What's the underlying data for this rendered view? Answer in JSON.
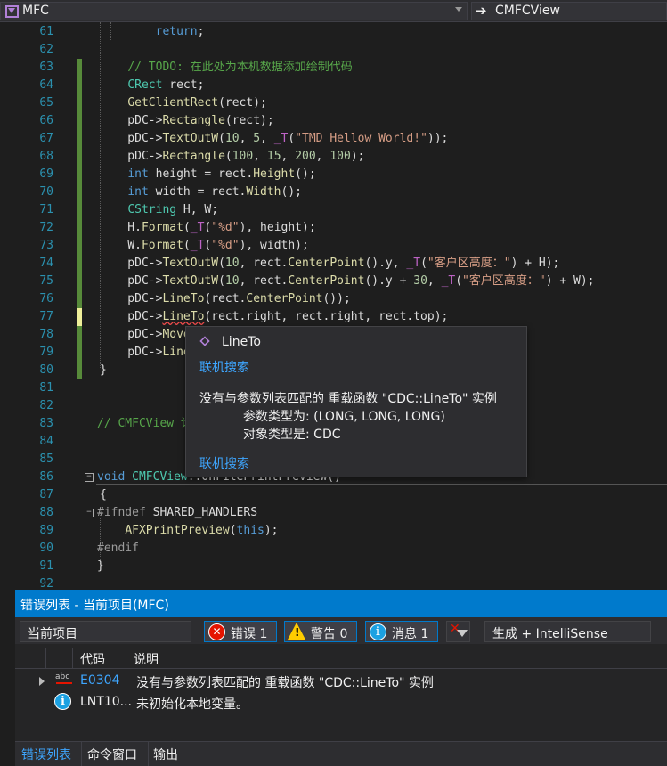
{
  "nav": {
    "project": "MFC",
    "member": "CMFCView"
  },
  "editor": {
    "lines": [
      {
        "n": "61",
        "html": "        <span class=\"kw\">return</span>;"
      },
      {
        "n": "62",
        "html": ""
      },
      {
        "n": "63",
        "html": "    <span class=\"cm\">// TODO: 在此处为本机数据添加绘制代码</span>"
      },
      {
        "n": "64",
        "html": "    <span class=\"ty\">CRect</span> rect;"
      },
      {
        "n": "65",
        "html": "    <span class=\"fn\">GetClientRect</span>(rect);"
      },
      {
        "n": "66",
        "html": "    pDC-&gt;<span class=\"fn\">Rectangle</span>(rect);"
      },
      {
        "n": "67",
        "html": "    pDC-&gt;<span class=\"fn\">TextOutW</span>(<span class=\"num\">10</span>, <span class=\"num\">5</span>, <span class=\"mac\">_T</span>(<span class=\"str\">\"TMD Hellow World!\"</span>));"
      },
      {
        "n": "68",
        "html": "    pDC-&gt;<span class=\"fn\">Rectangle</span>(<span class=\"num\">100</span>, <span class=\"num\">15</span>, <span class=\"num\">200</span>, <span class=\"num\">100</span>);"
      },
      {
        "n": "69",
        "html": "    <span class=\"kw\">int</span> height = rect.<span class=\"fn\">Height</span>();"
      },
      {
        "n": "70",
        "html": "    <span class=\"kw\">int</span> width = rect.<span class=\"fn\">Width</span>();"
      },
      {
        "n": "71",
        "html": "    <span class=\"ty\">CString</span> H, W;"
      },
      {
        "n": "72",
        "html": "    H.<span class=\"fn\">Format</span>(<span class=\"mac\">_T</span>(<span class=\"str\">\"%d\"</span>), height);"
      },
      {
        "n": "73",
        "html": "    W.<span class=\"fn\">Format</span>(<span class=\"mac\">_T</span>(<span class=\"str\">\"%d\"</span>), width);"
      },
      {
        "n": "74",
        "html": "    pDC-&gt;<span class=\"fn\">TextOutW</span>(<span class=\"num\">10</span>, rect.<span class=\"fn\">CenterPoint</span>().y, <span class=\"mac\">_T</span>(<span class=\"str\">\"客户区高度：\"</span>) + H);"
      },
      {
        "n": "75",
        "html": "    pDC-&gt;<span class=\"fn\">TextOutW</span>(<span class=\"num\">10</span>, rect.<span class=\"fn\">CenterPoint</span>().y + <span class=\"num\">30</span>, <span class=\"mac\">_T</span>(<span class=\"str\">\"客户区高度：\"</span>) + W);"
      },
      {
        "n": "76",
        "html": "    pDC-&gt;<span class=\"fn\">LineTo</span>(rect.<span class=\"fn\">CenterPoint</span>());"
      },
      {
        "n": "77",
        "html": "    pDC-&gt;<span class=\"fn squig\">LineTo</span>(rect.right, rect.right, rect.top);"
      },
      {
        "n": "78",
        "html": "    pDC-&gt;<span class=\"fn\">Move</span>"
      },
      {
        "n": "79",
        "html": "    pDC-&gt;<span class=\"fn\">Line</span>"
      },
      {
        "n": "80",
        "html": "}"
      },
      {
        "n": "81",
        "html": ""
      },
      {
        "n": "82",
        "html": ""
      },
      {
        "n": "83",
        "html": "<span class=\"cm\">// CMFCView 诊</span>"
      },
      {
        "n": "84",
        "html": ""
      },
      {
        "n": "85",
        "html": ""
      },
      {
        "n": "86",
        "html": "<span class=\"kw\">void</span> <span class=\"ty\">CMFCView</span>::OnFilePrintPreview()"
      },
      {
        "n": "87",
        "html": "{"
      },
      {
        "n": "88",
        "html": "<span class=\"pre\">#ifndef</span> SHARED_HANDLERS"
      },
      {
        "n": "89",
        "html": "    <span class=\"fn\">AFXPrintPreview</span>(<span class=\"kw\">this</span>);"
      },
      {
        "n": "90",
        "html": "<span class=\"pre\">#endif</span>"
      },
      {
        "n": "91",
        "html": "}"
      },
      {
        "n": "92",
        "html": ""
      }
    ]
  },
  "tooltip": {
    "title": "LineTo",
    "search_link_top": "联机搜索",
    "message": "没有与参数列表匹配的 重载函数 \"CDC::LineTo\" 实例",
    "arg_types": "参数类型为:  (LONG, LONG, LONG)",
    "object_type": "对象类型是:  CDC",
    "search_link_bottom": "联机搜索"
  },
  "error_list": {
    "title": "错误列表 - 当前项目(MFC)",
    "scope": "当前项目",
    "errors_label": "错误 1",
    "warnings_label": "警告 0",
    "messages_label": "消息 1",
    "build_filter": "生成 + IntelliSense",
    "col_code": "代码",
    "col_desc": "说明",
    "rows": [
      {
        "code": "E0304",
        "desc": "没有与参数列表匹配的 重载函数 \"CDC::LineTo\" 实例"
      },
      {
        "code": "LNT10...",
        "desc": "未初始化本地变量。"
      }
    ]
  },
  "bottom_tabs": {
    "error_list": "错误列表",
    "command_window": "命令窗口",
    "output": "输出"
  }
}
